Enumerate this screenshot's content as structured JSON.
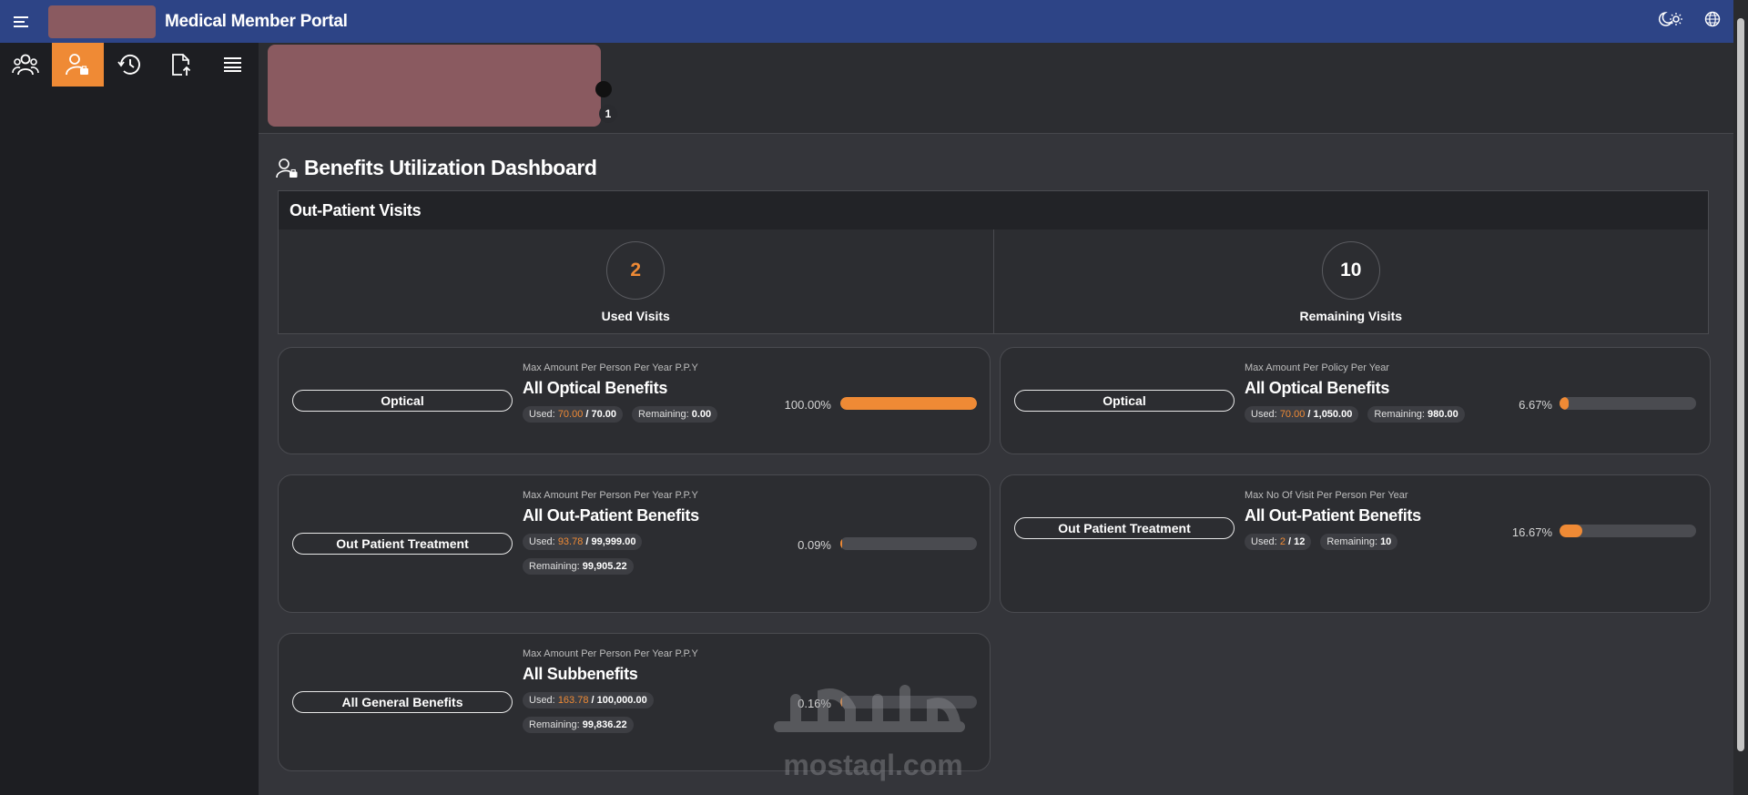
{
  "header": {
    "title": "Medical Member Portal"
  },
  "member": {
    "badge": "1"
  },
  "dashboard": {
    "title": "Benefits Utilization Dashboard"
  },
  "outpatient": {
    "heading": "Out-Patient Visits",
    "used": {
      "value": "2",
      "label": "Used Visits"
    },
    "remaining": {
      "value": "10",
      "label": "Remaining Visits"
    }
  },
  "labels": {
    "used": "Used:",
    "remaining": "Remaining:"
  },
  "cards": [
    {
      "pill": "Optical",
      "subtitle": "Max Amount Per Person Per Year P.P.Y",
      "title": "All Optical Benefits",
      "used": "70.00",
      "total": "/ 70.00",
      "remaining": "0.00",
      "percent_text": "100.00%",
      "percent": 100
    },
    {
      "pill": "Optical",
      "subtitle": "Max Amount Per Policy Per Year",
      "title": "All Optical Benefits",
      "used": "70.00",
      "total": "/ 1,050.00",
      "remaining": "980.00",
      "percent_text": "6.67%",
      "percent": 6.67
    },
    {
      "pill": "Out Patient Treatment",
      "subtitle": "Max Amount Per Person Per Year P.P.Y",
      "title": "All Out-Patient Benefits",
      "used": "93.78",
      "total": "/ 99,999.00",
      "remaining": "99,905.22",
      "percent_text": "0.09%",
      "percent": 0.09
    },
    {
      "pill": "Out Patient Treatment",
      "subtitle": "Max No Of Visit Per Person Per Year",
      "title": "All Out-Patient Benefits",
      "used": "2",
      "total": "/ 12",
      "remaining": "10",
      "percent_text": "16.67%",
      "percent": 16.67
    },
    {
      "pill": "All General Benefits",
      "subtitle": "Max Amount Per Person Per Year P.P.Y",
      "title": "All Subbenefits",
      "used": "163.78",
      "total": "/ 100,000.00",
      "remaining": "99,836.22",
      "percent_text": "0.16%",
      "percent": 0.16
    }
  ],
  "watermark": {
    "text": "mostaql.com"
  },
  "colors": {
    "accent": "#ef8a35",
    "header": "#2d4486"
  },
  "icons": {
    "menu": "menu-icon",
    "theme": "theme-toggle-icon",
    "language": "globe-icon"
  }
}
